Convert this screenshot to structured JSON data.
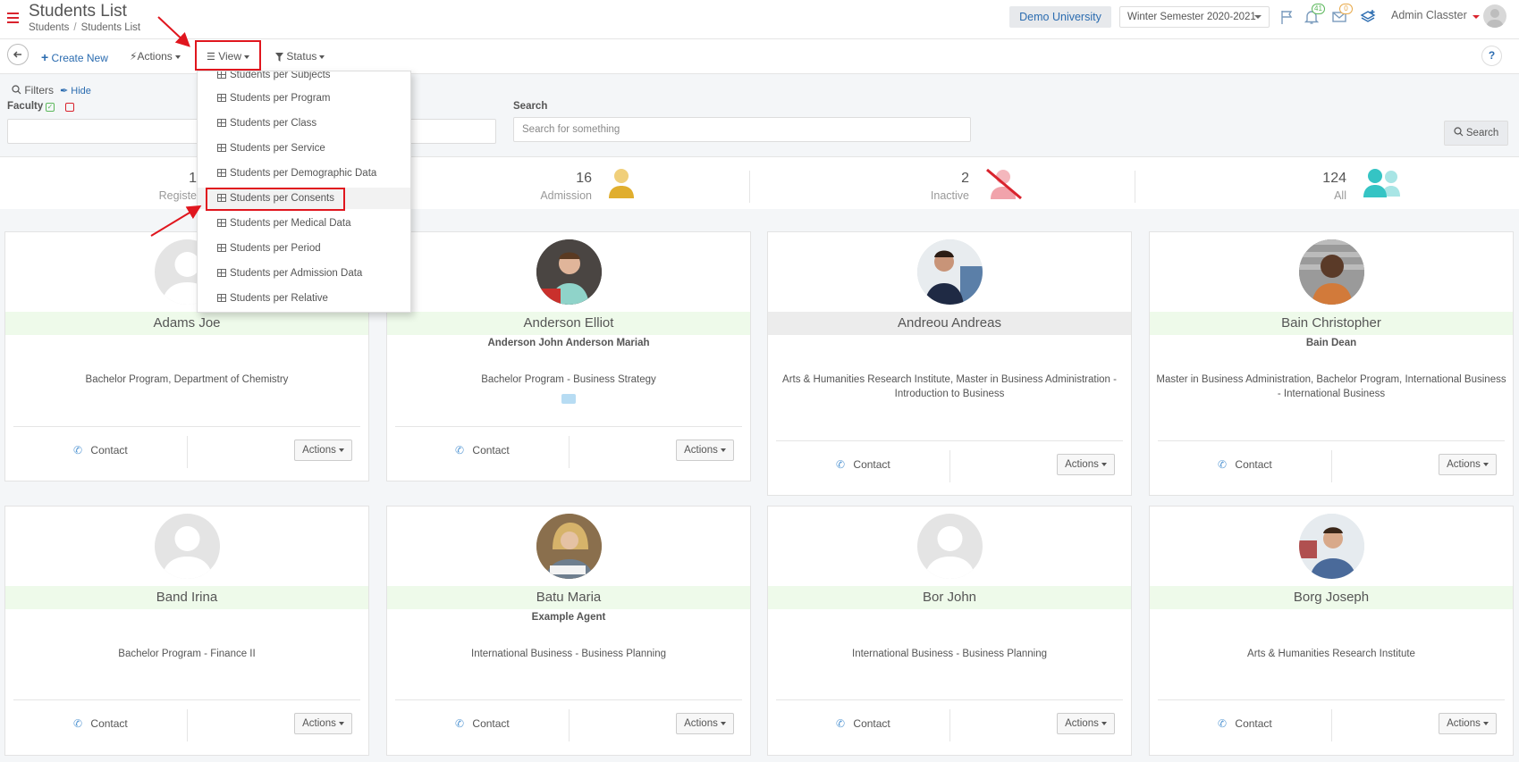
{
  "header": {
    "title": "Students List",
    "breadcrumb": [
      "Students",
      "Students List"
    ],
    "university": "Demo University",
    "semester": "Winter Semester 2020-2021",
    "notifications_count": "41",
    "messages_count": "0",
    "user": "Admin Classter"
  },
  "toolbar": {
    "create_new": "Create New",
    "actions": "Actions",
    "view": "View",
    "status": "Status",
    "help": "?"
  },
  "filters": {
    "filters_label": "Filters",
    "hide_label": "Hide",
    "faculty_label": "Faculty",
    "search_label": "Search",
    "search_placeholder": "Search for something",
    "search_button": "Search"
  },
  "stats": [
    {
      "value": "1",
      "label": "Registe"
    },
    {
      "value": "16",
      "label": "Admission"
    },
    {
      "value": "2",
      "label": "Inactive"
    },
    {
      "value": "124",
      "label": "All"
    }
  ],
  "view_menu": {
    "items": [
      "Students per Subjects",
      "Students per Program",
      "Students per Class",
      "Students per Service",
      "Students per Demographic Data",
      "Students per Consents",
      "Students per Medical Data",
      "Students per Period",
      "Students per Admission Data",
      "Students per Relative"
    ],
    "highlighted": "Students per Consents"
  },
  "cards": [
    {
      "name": "Adams Joe",
      "sub": "",
      "program": [
        "Bachelor Program, Department of Chemistry"
      ],
      "contact": "Contact",
      "actions": "Actions"
    },
    {
      "name": "Anderson Elliot",
      "sub": "Anderson John Anderson Mariah",
      "program": [
        "Bachelor Program  -  Business Strategy"
      ],
      "contact": "Contact",
      "actions": "Actions"
    },
    {
      "name": "Andreou Andreas",
      "sub": "",
      "program": [
        "Arts & Humanities Research Institute, Master in Business Administration  -",
        "Introduction to Business"
      ],
      "contact": "Contact",
      "actions": "Actions"
    },
    {
      "name": "Bain Christopher",
      "sub": "Bain Dean",
      "program": [
        "Master in Business Administration, Bachelor Program, International Business",
        " -  International Business"
      ],
      "contact": "Contact",
      "actions": "Actions"
    },
    {
      "name": "Band Irina",
      "sub": "",
      "program": [
        "Bachelor Program  -  Finance II"
      ],
      "contact": "Contact",
      "actions": "Actions"
    },
    {
      "name": "Batu Maria",
      "sub": "Example Agent",
      "program": [
        "International Business  -  Business Planning"
      ],
      "contact": "Contact",
      "actions": "Actions"
    },
    {
      "name": "Bor John",
      "sub": "",
      "program": [
        "International Business  -  Business Planning"
      ],
      "contact": "Contact",
      "actions": "Actions"
    },
    {
      "name": "Borg Joseph",
      "sub": "",
      "program": [
        "Arts & Humanities Research Institute"
      ],
      "contact": "Contact",
      "actions": "Actions"
    }
  ],
  "colors": {
    "accent_red": "#d9232d",
    "link_blue": "#2b6cb0",
    "name_bar": "#eefaea",
    "highlight": "#e0161e"
  }
}
